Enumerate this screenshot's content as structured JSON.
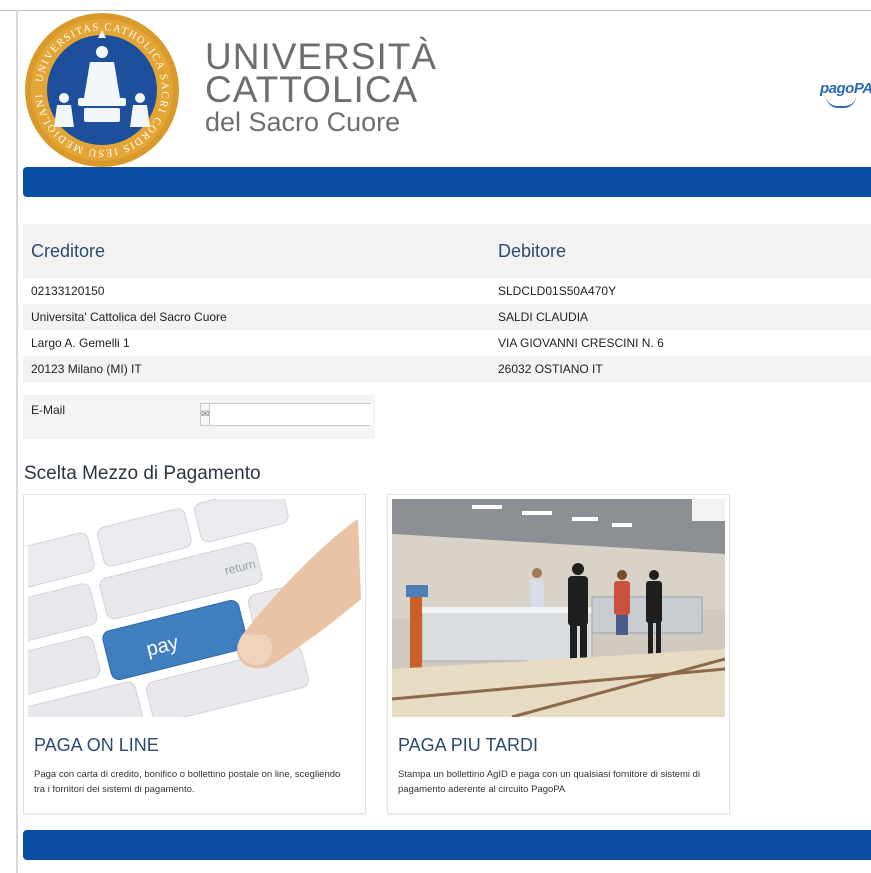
{
  "header": {
    "seal_text": "UNIVERSITAS CATHOLICA SACRI CORDIS IESU MEDIOLANI",
    "university_name": {
      "line1": "UNIVERSITÀ",
      "line2": "CATTOLICA",
      "line3": "del Sacro Cuore"
    },
    "payment_brand": "pagoPA"
  },
  "parties": {
    "creditor_heading": "Creditore",
    "debtor_heading": "Debitore",
    "rows": [
      {
        "creditor": "02133120150",
        "debtor": "SLDCLD01S50A470Y"
      },
      {
        "creditor": "Universita' Cattolica del Sacro Cuore",
        "debtor": "SALDI CLAUDIA"
      },
      {
        "creditor": "Largo A. Gemelli 1",
        "debtor": "VIA GIOVANNI CRESCINI N. 6"
      },
      {
        "creditor": "20123 Milano (MI) IT",
        "debtor": "26032 OSTIANO IT"
      }
    ]
  },
  "email": {
    "label": "E-Mail",
    "value": "",
    "placeholder": "",
    "addon_icon": "envelope-icon",
    "addon_glyph": "✉"
  },
  "payment_method": {
    "section_title": "Scelta Mezzo di Pagamento",
    "options": [
      {
        "title": "PAGA ON LINE",
        "description": "Paga con carta di credito, bonifico o bollettino postale on line, scegliendo tra i fornitori dei sistemi di pagamento.",
        "key_label": "pay",
        "key_label_2": "return"
      },
      {
        "title": "PAGA PIU TARDI",
        "description": "Stampa un bollettino AgID e paga con un qualsiasi fornitore di sistemi di pagamento aderente al circuito PagoPA"
      }
    ]
  },
  "colors": {
    "brand_bar": "#0a4ea4",
    "heading": "#2b4b6e",
    "seal_gold": "#d99a2b",
    "seal_blue": "#1d4f9c"
  }
}
